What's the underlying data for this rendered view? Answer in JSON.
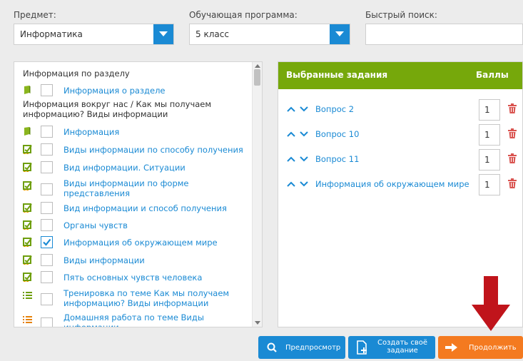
{
  "filters": {
    "subject_label": "Предмет:",
    "subject_value": "Информатика",
    "program_label": "Обучающая программа:",
    "program_value": "5 класс",
    "search_label": "Быстрый поиск:",
    "search_value": ""
  },
  "tree": {
    "section1": "Информация по разделу",
    "section1_item": "Информация о разделе",
    "section2_line1": "Информация вокруг нас / Как мы получаем",
    "section2_line2": "информацию? Виды информации",
    "items": [
      {
        "line1": "Информация",
        "line2": "",
        "icon": "book-icon",
        "checked": false
      },
      {
        "line1": "Виды информации по способу получения",
        "line2": "",
        "icon": "task-edit-icon",
        "checked": false
      },
      {
        "line1": "Вид информации. Ситуации",
        "line2": "",
        "icon": "task-edit-icon",
        "checked": false
      },
      {
        "line1": "Виды информации по форме",
        "line2": "представления",
        "icon": "task-edit-icon",
        "checked": false
      },
      {
        "line1": "Вид информации и способ получения",
        "line2": "",
        "icon": "task-edit-icon",
        "checked": false
      },
      {
        "line1": "Органы чувств",
        "line2": "",
        "icon": "task-edit-icon",
        "checked": false
      },
      {
        "line1": "Информация об окружающем мире",
        "line2": "",
        "icon": "task-edit-icon",
        "checked": true
      },
      {
        "line1": "Виды информации",
        "line2": "",
        "icon": "task-edit-icon",
        "checked": false
      },
      {
        "line1": "Пять основных чувств человека",
        "line2": "",
        "icon": "task-edit-icon",
        "checked": false
      },
      {
        "line1": "Тренировка по теме Как мы получаем",
        "line2": "информацию? Виды информации",
        "icon": "list-green-icon",
        "checked": false
      },
      {
        "line1": "Домашняя работа по теме Виды",
        "line2": "информации",
        "icon": "list-orange-icon",
        "checked": false
      }
    ]
  },
  "selected": {
    "title": "Выбранные задания",
    "score_header": "Баллы",
    "tasks": [
      {
        "name": "Вопрос 2",
        "score": "1"
      },
      {
        "name": "Вопрос 10",
        "score": "1"
      },
      {
        "name": "Вопрос 11",
        "score": "1"
      },
      {
        "name": "Информация об окружающем мире",
        "score": "1"
      }
    ]
  },
  "buttons": {
    "preview": "Предпросмотр",
    "create_line1": "Создать своё",
    "create_line2": "задание",
    "continue": "Продолжить"
  },
  "colors": {
    "accent_blue": "#1a8ad4",
    "header_green": "#76a80b",
    "continue_orange": "#f47a20",
    "arrow_red": "#c0141b",
    "trash_red": "#d9534f"
  }
}
